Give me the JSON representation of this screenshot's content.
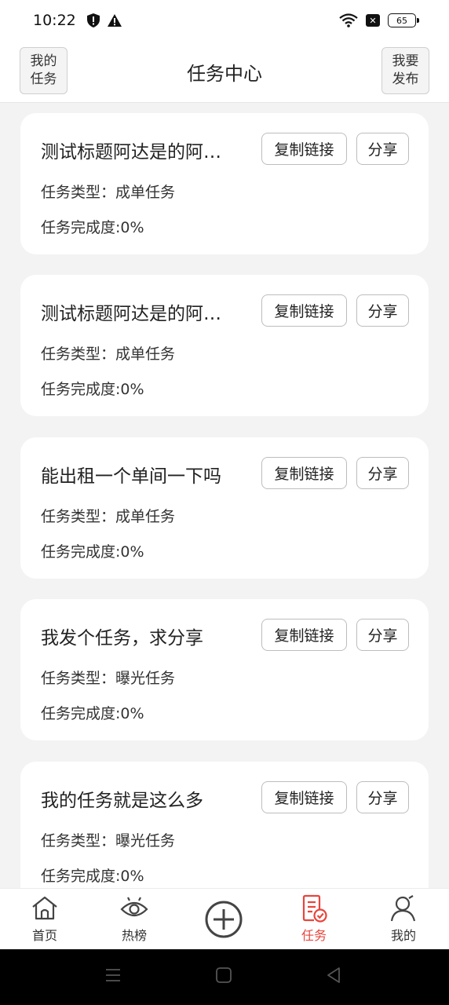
{
  "status_bar": {
    "time": "10:22",
    "battery": "65"
  },
  "header": {
    "left_button": "我的\n任务",
    "title": "任务中心",
    "right_button": "我要\n发布"
  },
  "buttons": {
    "copy_link": "复制链接",
    "share": "分享"
  },
  "tasks": [
    {
      "title": "测试标题阿达是的阿…",
      "type": "任务类型：成单任务",
      "progress": "任务完成度:0%"
    },
    {
      "title": "测试标题阿达是的阿…",
      "type": "任务类型：成单任务",
      "progress": "任务完成度:0%"
    },
    {
      "title": "能出租一个单间一下吗",
      "type": "任务类型：成单任务",
      "progress": "任务完成度:0%"
    },
    {
      "title": "我发个任务，求分享",
      "type": "任务类型：曝光任务",
      "progress": "任务完成度:0%"
    },
    {
      "title": "我的任务就是这么多",
      "type": "任务类型：曝光任务",
      "progress": "任务完成度:0%"
    }
  ],
  "bottom_nav": {
    "home": "首页",
    "hot": "热榜",
    "task": "任务",
    "mine": "我的"
  },
  "colors": {
    "accent": "#e8453c"
  }
}
